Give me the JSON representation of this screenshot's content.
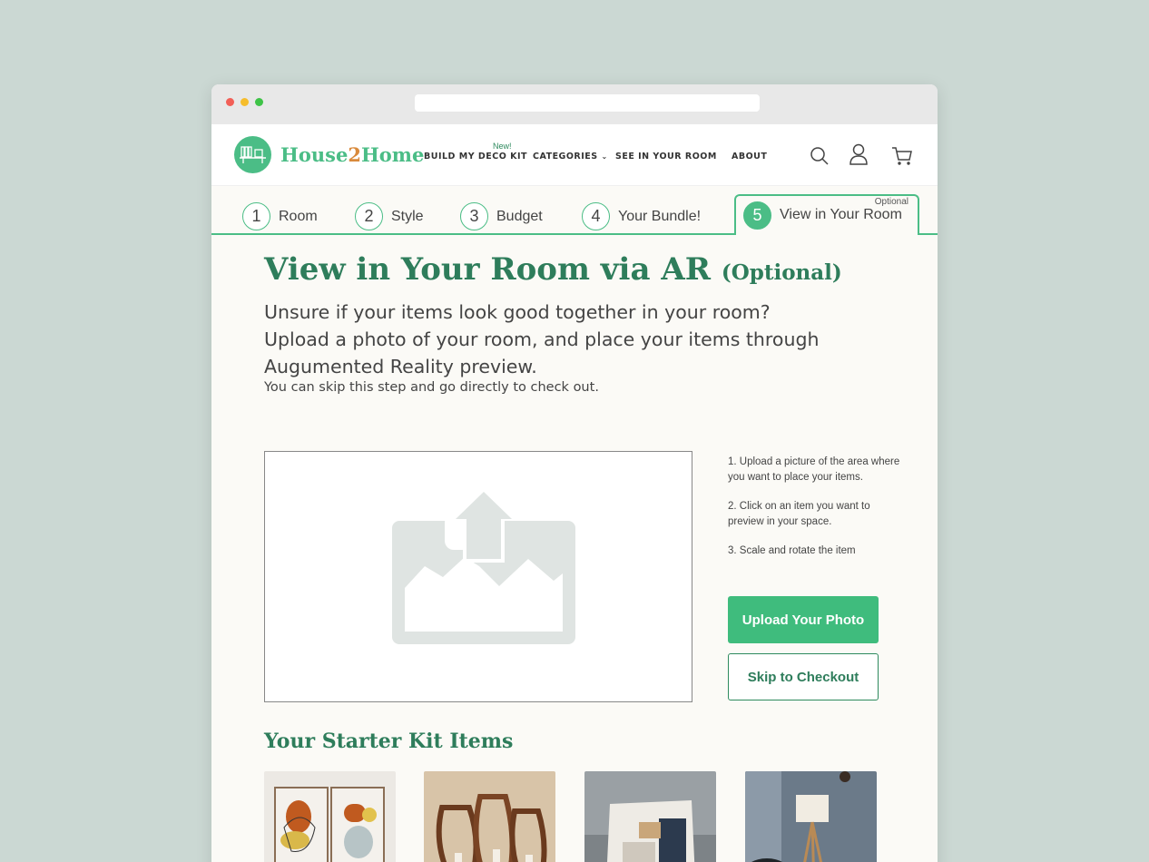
{
  "brand": {
    "part1": "House",
    "part2": "2",
    "part3": "Home"
  },
  "nav": {
    "new_badge": "New!",
    "build_kit": "BUILD MY DECO KIT",
    "categories": "CATEGORIES",
    "see_in_room": "SEE IN YOUR ROOM",
    "about": "ABOUT"
  },
  "steps": [
    {
      "num": "1",
      "label": "Room"
    },
    {
      "num": "2",
      "label": "Style"
    },
    {
      "num": "3",
      "label": "Budget"
    },
    {
      "num": "4",
      "label": "Your Bundle!"
    },
    {
      "num": "5",
      "label": "View in Your Room",
      "tag": "Optional"
    }
  ],
  "main": {
    "title": "View in Your Room via AR",
    "title_optional": "(Optional)",
    "intro": "Unsure if your items look good together in your room? Upload a photo of your room, and place your items through Augumented Reality preview.",
    "skip_note": "You can skip this step and go directly to check out."
  },
  "instructions": [
    "1. Upload a picture of the area where you want to place your items.",
    "2. Click on an item you want to preview in your space.",
    "3. Scale and rotate the item"
  ],
  "buttons": {
    "upload": "Upload Your Photo",
    "skip": "Skip to Checkout"
  },
  "kit": {
    "title": "Your Starter Kit Items"
  },
  "colors": {
    "accent": "#4bbd86",
    "heading": "#2e7d5b",
    "brand_two": "#d98a3c",
    "page_bg": "#cbd8d3"
  },
  "icons": [
    "search-icon",
    "user-icon",
    "cart-icon",
    "chevron-down-icon",
    "upload-image-icon",
    "shelf-logo-icon"
  ]
}
